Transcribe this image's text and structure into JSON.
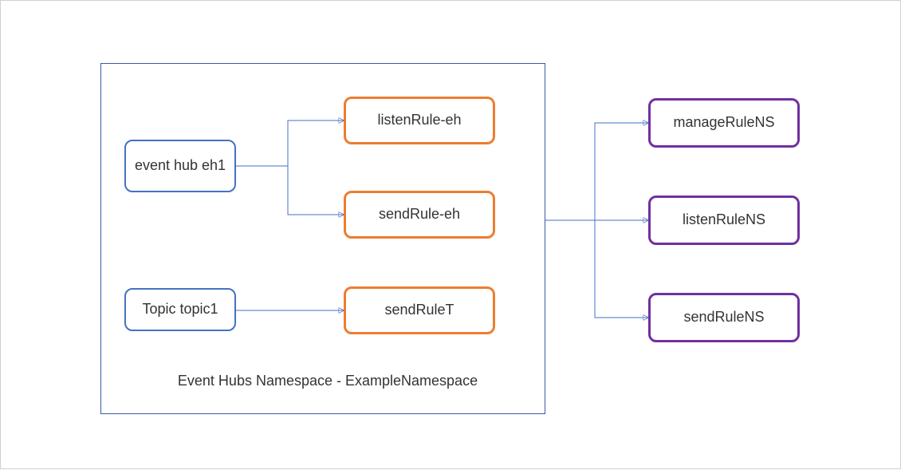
{
  "namespace": {
    "caption": "Event Hubs Namespace - ExampleNamespace"
  },
  "entities": {
    "eventhub": "event hub eh1",
    "topic": "Topic topic1"
  },
  "entityRules": {
    "listen_eh": "listenRule-eh",
    "send_eh": "sendRule-eh",
    "send_t": "sendRuleT"
  },
  "namespaceRules": {
    "manage": "manageRuleNS",
    "listen": "listenRuleNS",
    "send": "sendRuleNS"
  },
  "colors": {
    "entity_border": "#4472c4",
    "entity_rule_border": "#ed7d31",
    "namespace_rule_border": "#7030a0",
    "connector": "#4472c4"
  }
}
